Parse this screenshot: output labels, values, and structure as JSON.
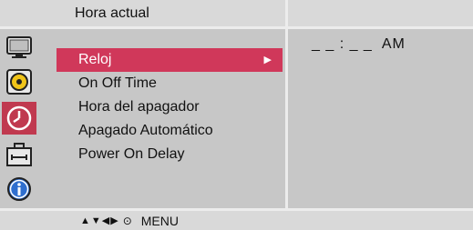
{
  "header": {
    "title": "Hora actual"
  },
  "sidebar": {
    "icons": [
      {
        "name": "picture-icon",
        "active": false
      },
      {
        "name": "audio-icon",
        "active": false
      },
      {
        "name": "clock-icon",
        "active": true
      },
      {
        "name": "toolbox-icon",
        "active": false
      },
      {
        "name": "info-icon",
        "active": false
      }
    ]
  },
  "menu": {
    "items": [
      {
        "label": "Reloj",
        "selected": true
      },
      {
        "label": "On Off Time",
        "selected": false
      },
      {
        "label": "Hora del apagador",
        "selected": false
      },
      {
        "label": "Apagado Automático",
        "selected": false
      },
      {
        "label": "Power On Delay",
        "selected": false
      }
    ],
    "selected_arrow": "▶"
  },
  "value_panel": {
    "time_value": "_ _ : _ _  AM"
  },
  "footer": {
    "nav_glyphs": "▲▼◀▶",
    "enter_glyph": "⊙",
    "menu_label": "MENU"
  },
  "colors": {
    "accent": "#d0385a",
    "panel_bg": "#c7c7c7",
    "bar_bg": "#d9d9d9"
  }
}
